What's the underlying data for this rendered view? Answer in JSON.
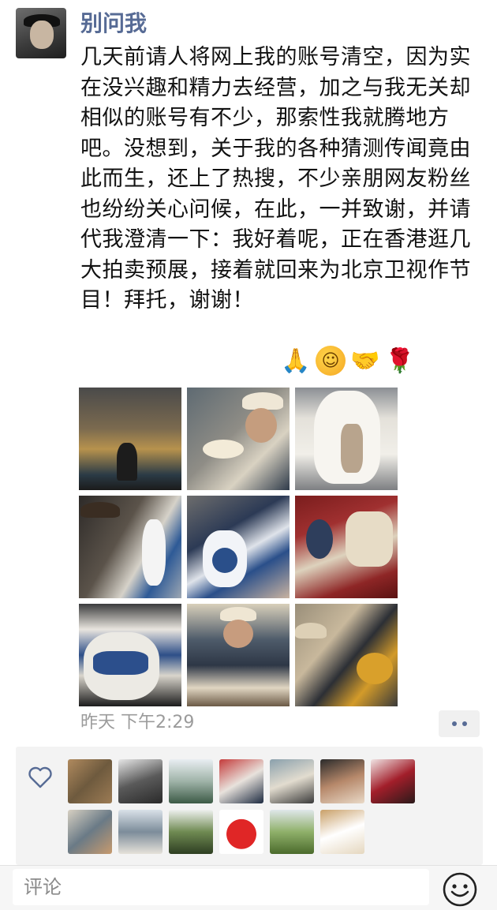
{
  "post": {
    "author": "别问我",
    "text": "几天前请人将网上我的账号清空，因为实在没兴趣和精力去经营，加之与我无关却相似的账号有不少，那索性我就腾地方吧。没想到，关于我的各种猜测传闻竟由此而生，还上了热搜，不少亲朋网友粉丝也纷纷关心问候，在此，一并致谢，并请代我澄清一下：我好着呢，正在香港逛几大拍卖预展，接着就回来为北京卫视作节目！拜托，谢谢！",
    "emojis": [
      "🙏",
      "☺",
      "🤝",
      "🌹"
    ],
    "timestamp": "昨天 下午2:29",
    "photo_count": 9
  },
  "likes": {
    "icon": "heart-icon",
    "count": 13
  },
  "comment_bar": {
    "placeholder": "评论",
    "emoji_icon": "smile-icon"
  },
  "colors": {
    "name_link": "#576b95",
    "text": "#111111",
    "meta": "#9b9b9b",
    "panel": "#f3f3f3"
  }
}
